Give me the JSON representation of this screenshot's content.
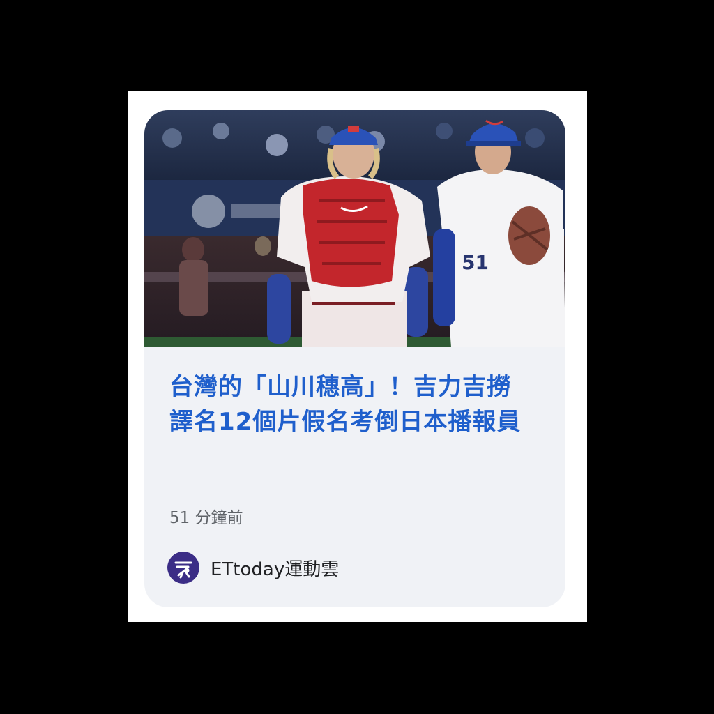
{
  "article": {
    "headline": "台灣的「山川穗高」！吉力吉撈譯名12個片假名考倒日本播報員",
    "time_ago": "51 分鐘前",
    "source_name": "ETtoday運動雲",
    "source_logo_icon": "ettoday-sports-logo-icon",
    "image_icon": "baseball-players-photo"
  },
  "colors": {
    "headline": "#1f5fcc",
    "time": "#5f6368",
    "source": "#202124",
    "card_bg": "#f0f2f6"
  }
}
